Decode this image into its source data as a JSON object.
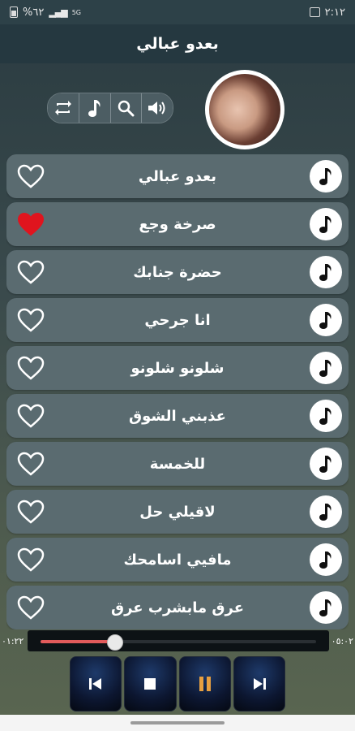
{
  "status_bar": {
    "time": "٢:١٢",
    "battery": "%٦٢",
    "signal_label": "5G"
  },
  "header": {
    "title": "بعدو عبالي"
  },
  "toolbar": {
    "icons": [
      "repeat-icon",
      "music-note-icon",
      "search-icon",
      "volume-icon"
    ]
  },
  "songs": [
    {
      "title": "بعدو عبالي",
      "favorite": false
    },
    {
      "title": "صرخة وجع",
      "favorite": true
    },
    {
      "title": "حضرة جنابك",
      "favorite": false
    },
    {
      "title": "انا جرحي",
      "favorite": false
    },
    {
      "title": "شلونو شلونو",
      "favorite": false
    },
    {
      "title": "عذبني الشوق",
      "favorite": false
    },
    {
      "title": "للخمسة",
      "favorite": false
    },
    {
      "title": "لاقيلي حل",
      "favorite": false
    },
    {
      "title": "مافيي اسامحك",
      "favorite": false
    },
    {
      "title": "عرق مابشرب عرق",
      "favorite": false
    }
  ],
  "player": {
    "elapsed": "٠١:٢٢",
    "duration": "٠٥:٠٢",
    "progress": 0.27
  },
  "colors": {
    "heart_active": "#e0141e",
    "seek_fill": "#e25b5b",
    "pause_accent": "#e8a040"
  }
}
